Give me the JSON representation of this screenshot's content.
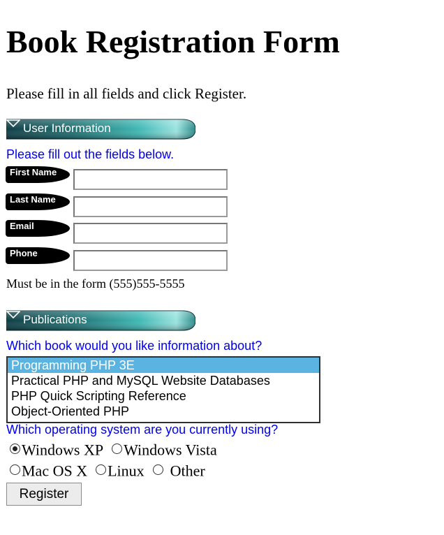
{
  "page": {
    "title": "Book Registration Form",
    "intro": "Please fill in all fields and click Register."
  },
  "user_section": {
    "banner_label": "User Information",
    "instructions": "Please fill out the fields below.",
    "fields": [
      {
        "label": "First Name",
        "value": ""
      },
      {
        "label": "Last Name",
        "value": ""
      },
      {
        "label": "Email",
        "value": ""
      },
      {
        "label": "Phone",
        "value": ""
      }
    ],
    "phone_hint": "Must be in the form (555)555-5555"
  },
  "publications": {
    "banner_label": "Publications",
    "book_question": "Which book would you like information about?",
    "books": [
      "Programming PHP 3E",
      "Practical PHP and MySQL Website Databases",
      "PHP Quick Scripting Reference",
      "Object-Oriented PHP"
    ],
    "selected_book": "Programming PHP 3E",
    "os_question": "Which operating system are you currently using?",
    "os_options": [
      "Windows XP",
      "Windows Vista",
      "Mac OS X",
      "Linux",
      "Other"
    ],
    "selected_os": "Windows XP"
  },
  "form": {
    "submit_label": "Register"
  },
  "colors": {
    "banner_teal": "#3fb8b4",
    "banner_dark": "#0f3f46",
    "link_blue": "#0000ee",
    "listbox_selected": "#5ab3e0"
  }
}
